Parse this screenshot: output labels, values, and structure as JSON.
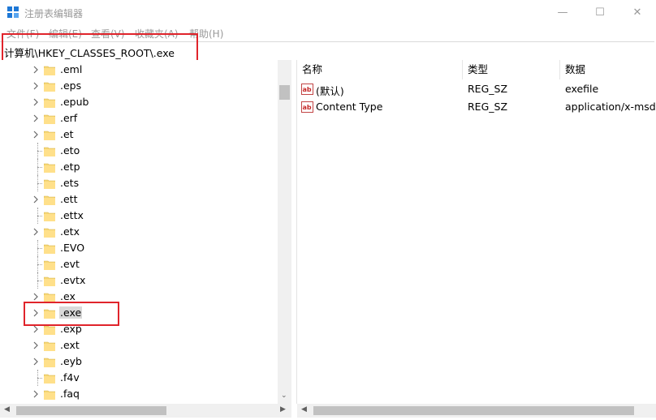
{
  "window": {
    "title": "注册表编辑器",
    "minimize": "—",
    "maximize": "☐",
    "close": "✕"
  },
  "menu": [
    "文件(F)",
    "编辑(E)",
    "查看(V)",
    "收藏夹(A)",
    "帮助(H)"
  ],
  "address": "计算机\\HKEY_CLASSES_ROOT\\.exe",
  "tree": [
    {
      "label": ".eml",
      "expandable": true
    },
    {
      "label": ".eps",
      "expandable": true
    },
    {
      "label": ".epub",
      "expandable": true
    },
    {
      "label": ".erf",
      "expandable": true
    },
    {
      "label": ".et",
      "expandable": true
    },
    {
      "label": ".eto",
      "expandable": false
    },
    {
      "label": ".etp",
      "expandable": false
    },
    {
      "label": ".ets",
      "expandable": false
    },
    {
      "label": ".ett",
      "expandable": true
    },
    {
      "label": ".ettx",
      "expandable": false
    },
    {
      "label": ".etx",
      "expandable": true
    },
    {
      "label": ".EVO",
      "expandable": false
    },
    {
      "label": ".evt",
      "expandable": false
    },
    {
      "label": ".evtx",
      "expandable": false
    },
    {
      "label": ".ex",
      "expandable": true
    },
    {
      "label": ".exe",
      "expandable": true,
      "selected": true
    },
    {
      "label": ".exp",
      "expandable": true
    },
    {
      "label": ".ext",
      "expandable": true
    },
    {
      "label": ".eyb",
      "expandable": true
    },
    {
      "label": ".f4v",
      "expandable": false
    },
    {
      "label": ".faq",
      "expandable": true
    }
  ],
  "columns": [
    "名称",
    "类型",
    "数据"
  ],
  "values": [
    {
      "name": "(默认)",
      "type": "REG_SZ",
      "data": "exefile"
    },
    {
      "name": "Content Type",
      "type": "REG_SZ",
      "data": "application/x-msdownload"
    }
  ]
}
